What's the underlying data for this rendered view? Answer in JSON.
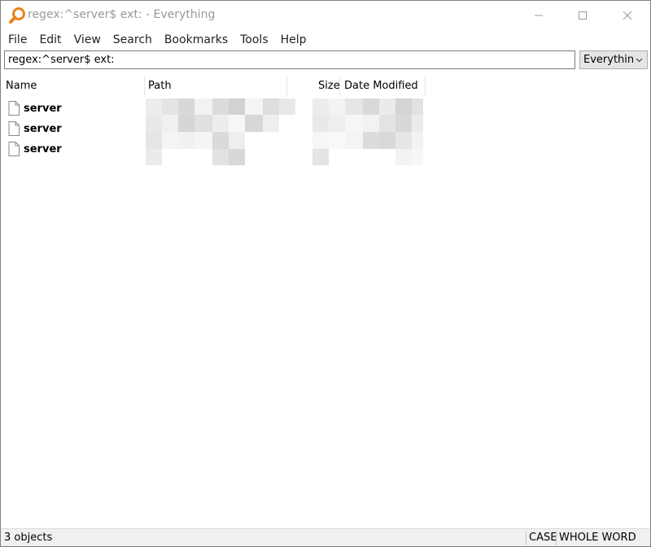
{
  "window": {
    "title": "regex:^server$ ext: - Everything"
  },
  "menu": [
    {
      "label": "File"
    },
    {
      "label": "Edit"
    },
    {
      "label": "View"
    },
    {
      "label": "Search"
    },
    {
      "label": "Bookmarks"
    },
    {
      "label": "Tools"
    },
    {
      "label": "Help"
    }
  ],
  "search": {
    "value": "regex:^server$ ext:"
  },
  "filter": {
    "selected": "Everything"
  },
  "columns": {
    "name": "Name",
    "path": "Path",
    "size": "Size",
    "date_modified": "Date Modified"
  },
  "results": [
    {
      "name": "server",
      "icon": "file-icon"
    },
    {
      "name": "server",
      "icon": "file-icon"
    },
    {
      "name": "server",
      "icon": "file-icon"
    }
  ],
  "status": {
    "count": "3 objects",
    "case": "CASE",
    "whole_word": "WHOLE WORD"
  },
  "colors": {
    "accent_icon": "#e8821e",
    "title_text": "#999999",
    "status_bg": "#f0f0f0"
  }
}
